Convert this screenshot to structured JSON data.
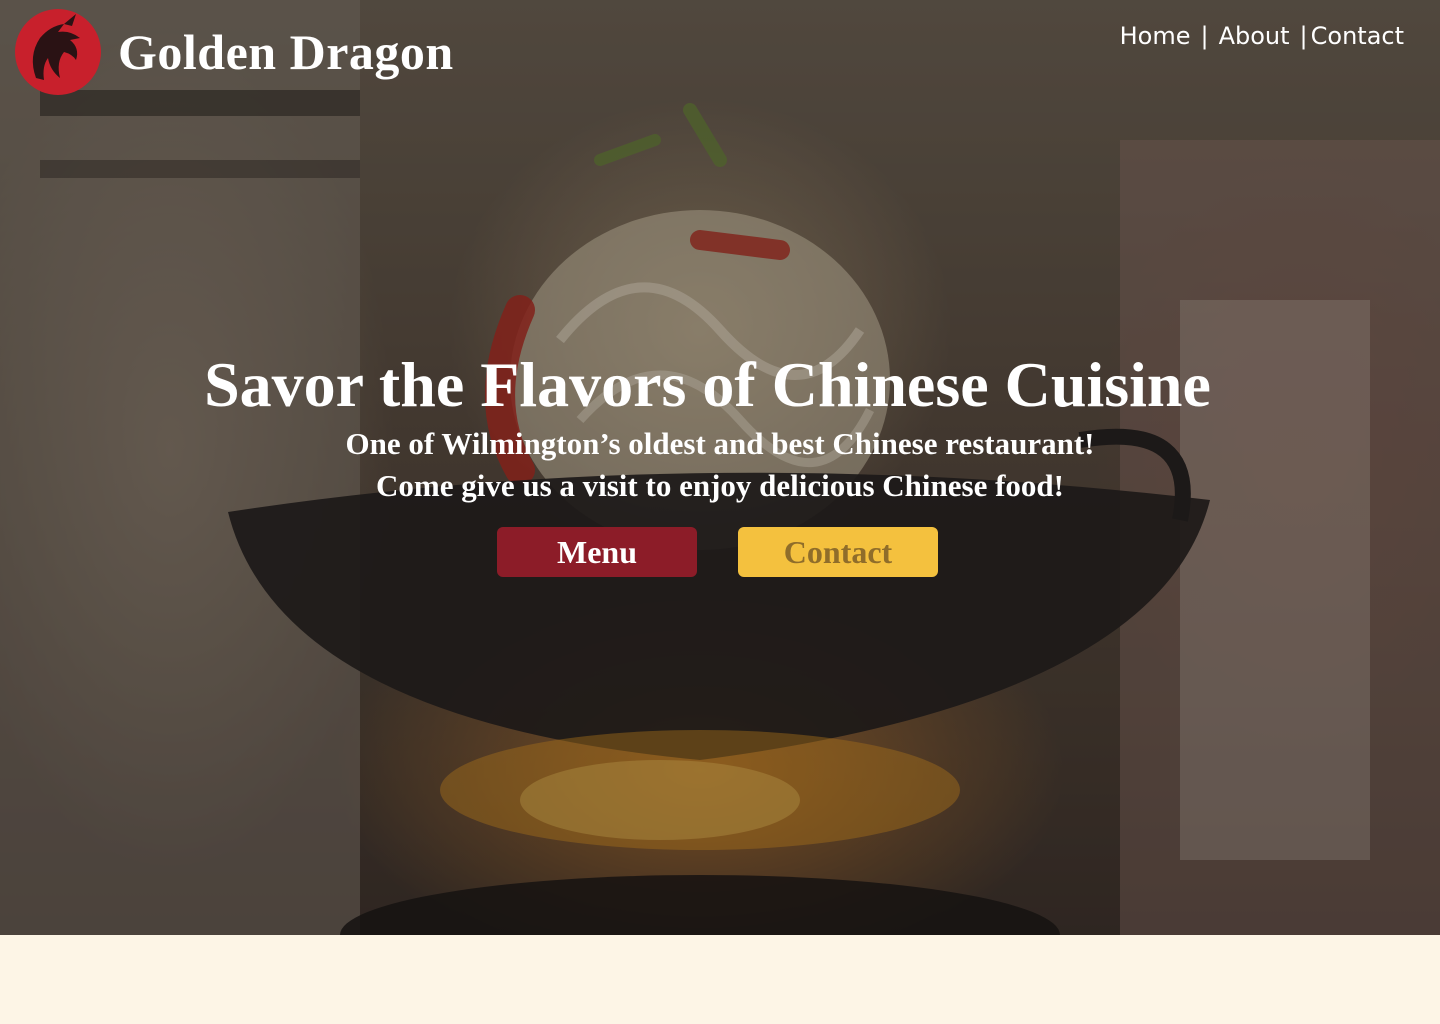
{
  "brand": {
    "name": "Golden Dragon",
    "logo_icon": "dragon-icon",
    "logo_color": "#c8202c"
  },
  "nav": {
    "items": [
      "Home",
      "About",
      "Contact"
    ],
    "separator": "|"
  },
  "hero": {
    "headline": "Savor the Flavors of Chinese Cuisine",
    "subline1": "One of Wilmington’s oldest and best Chinese restaurant!",
    "subline2": "Come give us a visit to enjoy delicious Chinese food!",
    "buttons": {
      "menu": "Menu",
      "contact": "Contact"
    }
  },
  "colors": {
    "menu_button": "#8c1c28",
    "contact_button": "#f4c13e",
    "contact_button_text": "#8f6d2a",
    "page_background": "#fdf5e6"
  }
}
